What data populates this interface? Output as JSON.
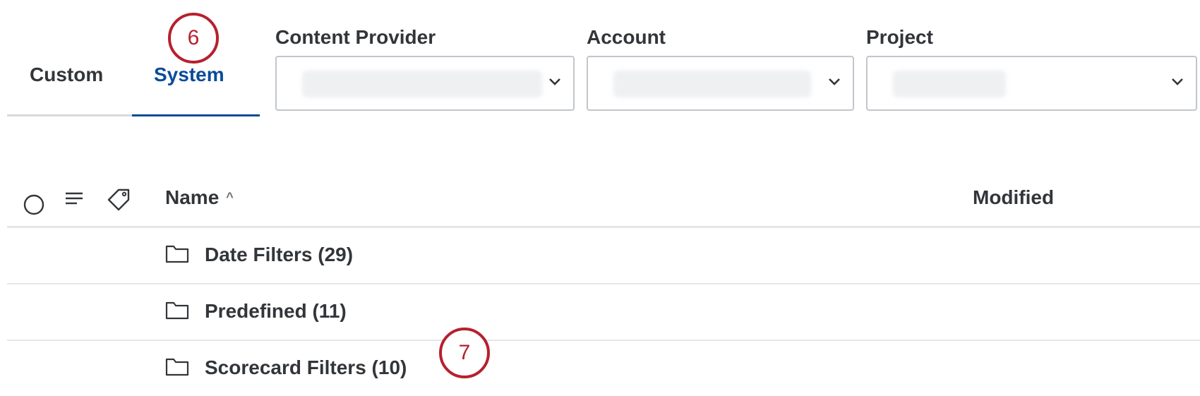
{
  "tabs": [
    {
      "label": "Custom",
      "active": false
    },
    {
      "label": "System",
      "active": true
    }
  ],
  "callouts": {
    "tabs": "6",
    "list": "7"
  },
  "filters": {
    "content_provider": {
      "label": "Content Provider"
    },
    "account": {
      "label": "Account"
    },
    "project": {
      "label": "Project"
    }
  },
  "table": {
    "columns": {
      "name": "Name",
      "modified": "Modified"
    },
    "sort_indicator": "^",
    "rows": [
      {
        "label": "Date Filters (29)"
      },
      {
        "label": "Predefined (11)"
      },
      {
        "label": "Scorecard Filters (10)"
      }
    ]
  },
  "icons": {
    "select_all": "circle-radio-icon",
    "menu": "lines-menu-icon",
    "tag": "tag-icon",
    "folder": "folder-icon",
    "dropdown": "chevron-down-icon"
  },
  "colors": {
    "accent": "#0a4a9a",
    "callout": "#b7202e",
    "text": "#32363a",
    "divider": "#e4e6e8"
  }
}
